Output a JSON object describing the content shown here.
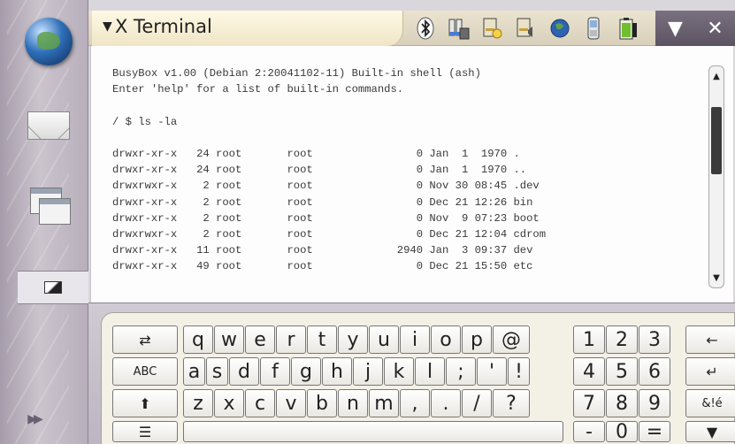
{
  "window": {
    "title": "X Terminal",
    "menu_glyph": "▼"
  },
  "window_controls": {
    "minimize": "▼",
    "close": "✕"
  },
  "status_icons": [
    "bluetooth-icon",
    "connectivity-icon",
    "display-brightness-icon",
    "volume-icon",
    "internet-globe-icon",
    "phone-icon",
    "battery-icon"
  ],
  "sidebar": {
    "expand_glyph": "▶▶"
  },
  "terminal": {
    "lines": [
      "BusyBox v1.00 (Debian 2:20041102-11) Built-in shell (ash)",
      "Enter 'help' for a list of built-in commands.",
      "",
      "/ $ ls -la",
      "",
      "drwxr-xr-x   24 root       root                0 Jan  1  1970 .",
      "drwxr-xr-x   24 root       root                0 Jan  1  1970 ..",
      "drwxrwxr-x    2 root       root                0 Nov 30 08:45 .dev",
      "drwxr-xr-x    2 root       root                0 Dec 21 12:26 bin",
      "drwxr-xr-x    2 root       root                0 Nov  9 07:23 boot",
      "drwxrwxr-x    2 root       root                0 Dec 21 12:04 cdrom",
      "drwxr-xr-x   11 root       root             2940 Jan  3 09:37 dev",
      "drwxr-xr-x   49 root       root                0 Dec 21 15:50 etc"
    ],
    "scroll_up": "▲",
    "scroll_down": "▼"
  },
  "keyboard": {
    "row1": [
      "⇄",
      "q",
      "w",
      "e",
      "r",
      "t",
      "y",
      "u",
      "i",
      "o",
      "p",
      "@",
      "1",
      "2",
      "3",
      "←"
    ],
    "row2": [
      "ABC",
      "a",
      "s",
      "d",
      "f",
      "g",
      "h",
      "j",
      "k",
      "l",
      ";",
      "'",
      "!",
      "4",
      "5",
      "6",
      "↵"
    ],
    "row3": [
      "⬆",
      "z",
      "x",
      "c",
      "v",
      "b",
      "n",
      "m",
      ",",
      ".",
      "/",
      "?",
      "7",
      "8",
      "9",
      "&!é"
    ],
    "row4": [
      "☰",
      "",
      "-",
      "0",
      "=",
      "▼"
    ]
  }
}
